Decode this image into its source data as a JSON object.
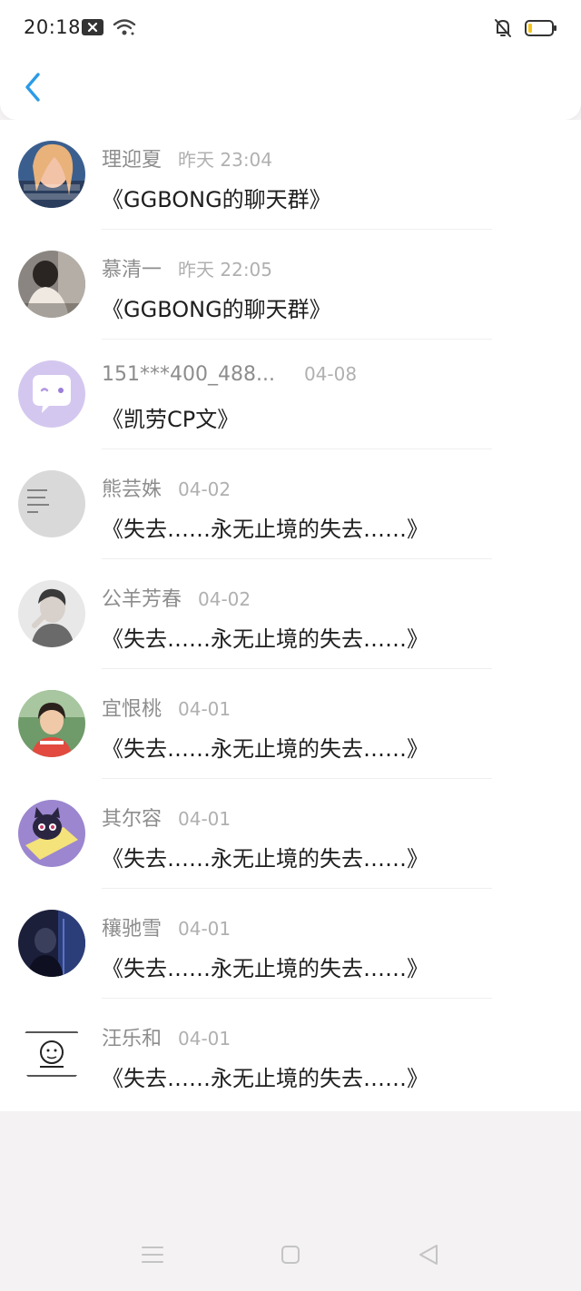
{
  "status_bar": {
    "time": "20:18",
    "icons": [
      "notification-close-icon",
      "wifi-icon",
      "mute-icon",
      "battery-low-icon"
    ]
  },
  "header": {
    "back_icon": "chevron-left-icon"
  },
  "list": {
    "items": [
      {
        "user": "理迎夏",
        "time": "昨天 23:04",
        "title": "《GGBONG的聊天群》"
      },
      {
        "user": "慕清一",
        "time": "昨天 22:05",
        "title": "《GGBONG的聊天群》"
      },
      {
        "user": "151***400_488...",
        "time": "04-08",
        "title": "《凯劳CP文》"
      },
      {
        "user": "熊芸姝",
        "time": "04-02",
        "title": "《失去……永无止境的失去……》"
      },
      {
        "user": "公羊芳春",
        "time": "04-02",
        "title": "《失去……永无止境的失去……》"
      },
      {
        "user": "宜恨桃",
        "time": "04-01",
        "title": "《失去……永无止境的失去……》"
      },
      {
        "user": "其尔容",
        "time": "04-01",
        "title": "《失去……永无止境的失去……》"
      },
      {
        "user": "穰驰雪",
        "time": "04-01",
        "title": "《失去……永无止境的失去……》"
      },
      {
        "user": "汪乐和",
        "time": "04-01",
        "title": "《失去……永无止境的失去……》"
      }
    ]
  },
  "nav": {
    "icons": [
      "menu-icon",
      "home-icon",
      "back-triangle-icon"
    ]
  },
  "colors": {
    "accent": "#2b9be6",
    "background": "#f4f2f3"
  }
}
